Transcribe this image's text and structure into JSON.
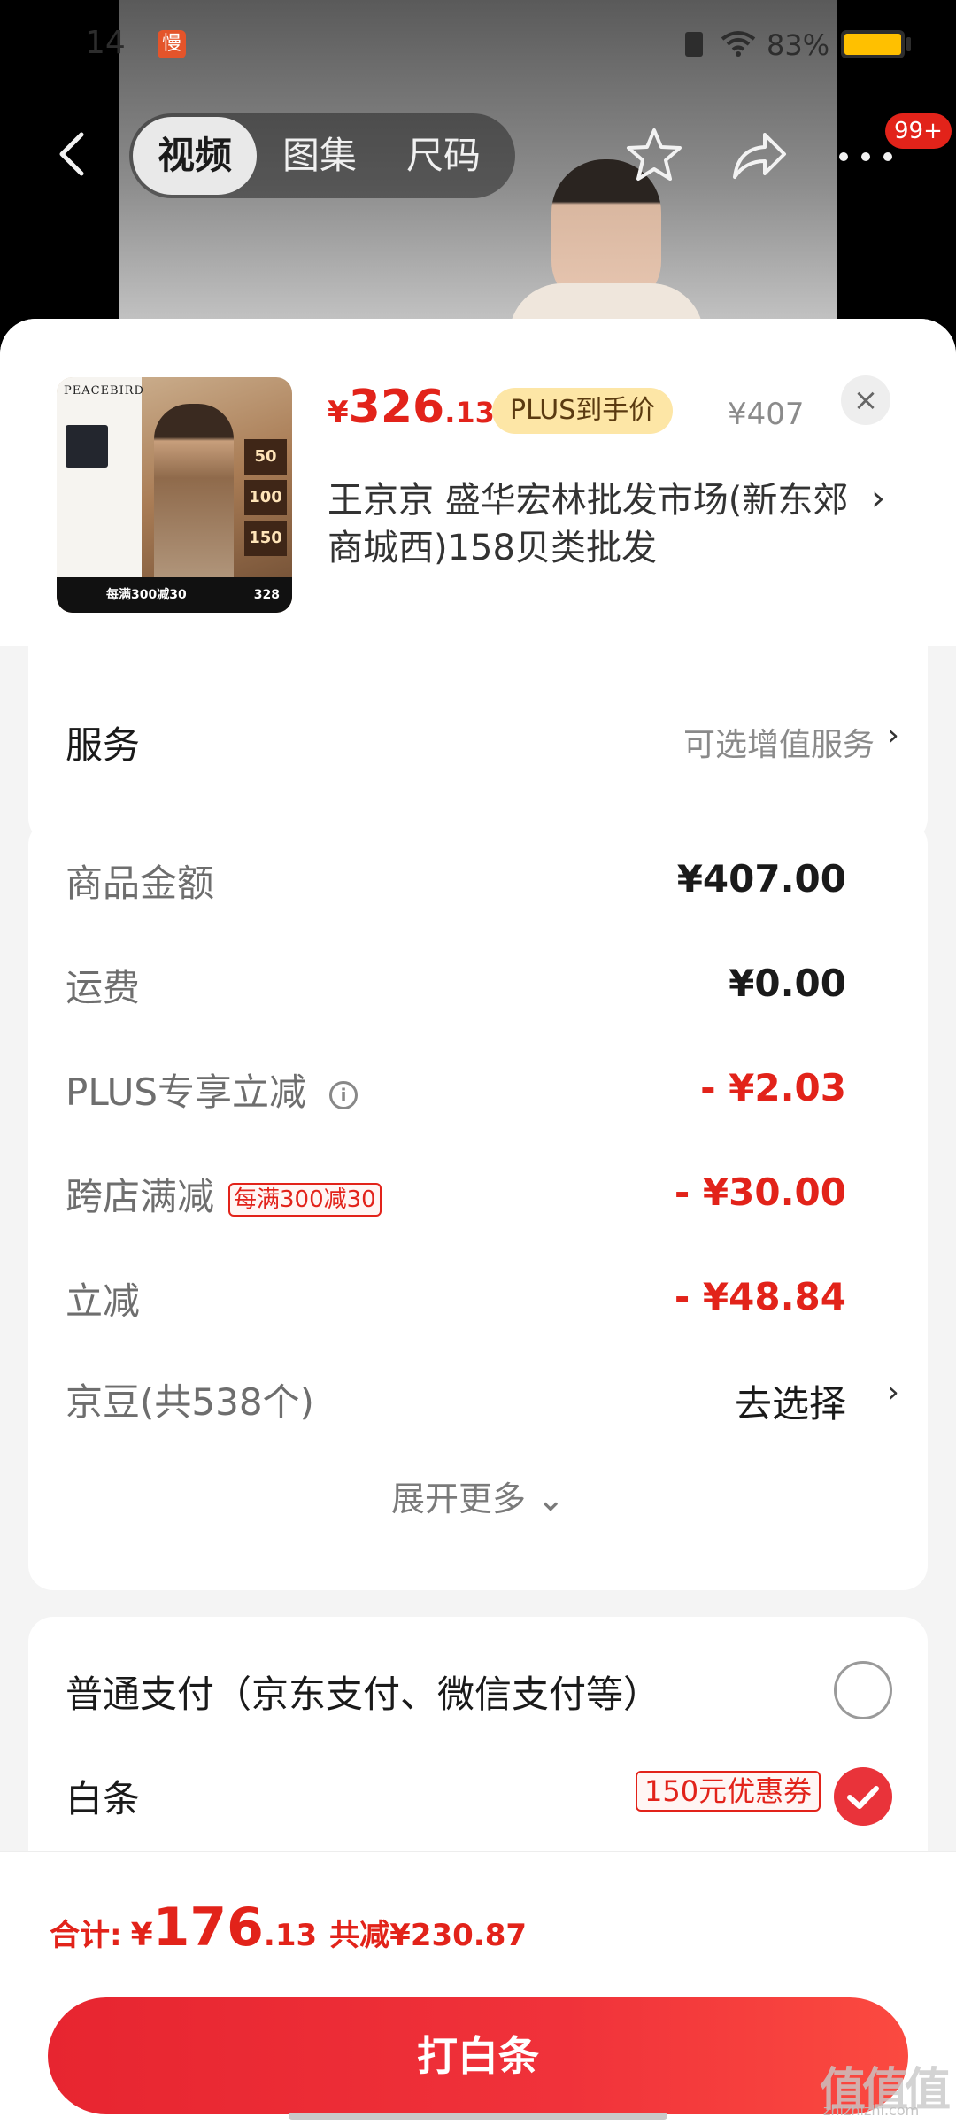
{
  "status_bar": {
    "time": "14",
    "slow_badge": "慢",
    "battery": "83%"
  },
  "nav": {
    "tabs": [
      {
        "label": "视频",
        "active": true
      },
      {
        "label": "图集",
        "active": false
      },
      {
        "label": "尺码",
        "active": false
      }
    ],
    "message_badge": "99+"
  },
  "product": {
    "thumbnail": {
      "brand": "PEACEBIRD",
      "tags": [
        "50",
        "100",
        "150"
      ],
      "promo": "每满300减30",
      "price": "328"
    },
    "price_currency": "¥",
    "price_integer": "326",
    "price_decimal": ".13",
    "plus_label": "PLUS到手价",
    "original_price": "¥407",
    "shop_name": "王京京  盛华宏林批发市场(新东郊商城西)158贝类批发",
    "close_label": "×"
  },
  "service": {
    "label": "服务",
    "value": "可选增值服务"
  },
  "amounts": {
    "rows": [
      {
        "label": "商品金额",
        "value": "¥407.00"
      },
      {
        "label": "运费",
        "value": "¥0.00"
      },
      {
        "label": "PLUS专享立减",
        "value": "- ¥2.03"
      },
      {
        "label": "跨店满减",
        "tag": "每满300减30",
        "value": "- ¥30.00"
      },
      {
        "label": "立减",
        "value": "- ¥48.84"
      },
      {
        "label": "京豆(共538个)",
        "value": "去选择"
      }
    ],
    "expand": "展开更多"
  },
  "payment": {
    "options": [
      {
        "label": "普通支付（京东支付、微信支付等）",
        "selected": false
      },
      {
        "label": "白条",
        "coupon": "150元优惠券",
        "selected": true
      }
    ]
  },
  "footer": {
    "total_label": "合计:",
    "total_currency": "¥",
    "total_integer": "176",
    "total_decimal": ".13",
    "saved": "共减¥230.87",
    "pay_button": "打白条"
  },
  "watermark": {
    "main": "值值值",
    "sub": "zhizhizhi.com"
  },
  "colors": {
    "accent": "#e2231a",
    "plus_pill": "#fde6a6",
    "background": "#f4f4f4"
  }
}
